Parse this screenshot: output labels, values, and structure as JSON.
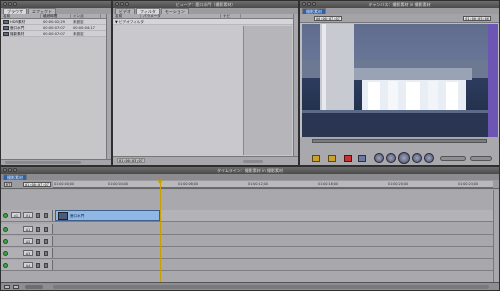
{
  "browser": {
    "title": "",
    "tabs": [
      "ブラウザ",
      "エフェクト"
    ],
    "columns": [
      "名前",
      "継続時間",
      "イン点"
    ],
    "items": [
      {
        "name": "HDR素材",
        "duration": "00:00:02;29",
        "in": "未設定"
      },
      {
        "name": "鹿口水門",
        "duration": "00:00:07:07",
        "in": "00:00:04:17"
      },
      {
        "name": "撮影素材",
        "duration": "00:00:07:07",
        "in": "未設定"
      }
    ]
  },
  "viewer": {
    "title": "ビューア：鹿口水門（撮影素材）",
    "tabs": [
      "ビデオ",
      "フィルタ",
      "モーション"
    ],
    "columns": [
      "名前",
      "パラメータ",
      "ナビ"
    ],
    "row": "▼ ビデオフィルタ",
    "timecode_bottom": "01:00:03;07"
  },
  "canvas": {
    "title": "キャンバス：撮影素材 in 撮影素材",
    "tab": "撮影素材",
    "timecode_left": "00:00:07:07",
    "timecode_right": "01:00:05;06"
  },
  "timeline": {
    "title": "タイムライン：撮影素材 in 撮影素材",
    "tab": "撮影素材",
    "timecode": "01:00:07:07",
    "rt_label": "RT",
    "ruler_ticks": [
      "01:00:00;00",
      "01:00:04;00",
      "01:00:08;00",
      "01:00:12;00",
      "01:00:16;00",
      "01:00:20;00",
      "01:00:24;00"
    ],
    "tracks": [
      {
        "dest": "v1",
        "label": "V1",
        "type": "video"
      },
      {
        "dest": "a1",
        "label": "A1",
        "type": "audio"
      },
      {
        "dest": "a2",
        "label": "A2",
        "type": "audio"
      },
      {
        "dest": "a3",
        "label": "A3",
        "type": "audio"
      },
      {
        "dest": "a4",
        "label": "A4",
        "type": "audio"
      }
    ],
    "clip_name": "鹿口水門"
  },
  "colors": {
    "accent_blue": "#2f60a8",
    "clip_blue": "#8fb8e6",
    "track_green": "#3fa447",
    "playhead": "#c8a000"
  }
}
